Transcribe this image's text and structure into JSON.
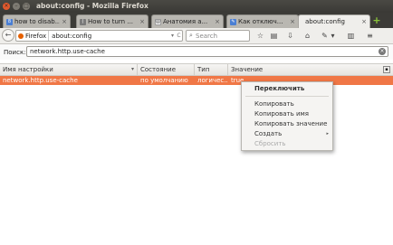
{
  "window": {
    "title": "about:config - Mozilla Firefox",
    "close_glyph": "×",
    "minimize_glyph": "–",
    "maximize_glyph": "□"
  },
  "tabs": [
    {
      "label": "how to disab...",
      "icon": "google-icon",
      "icon_char": "8",
      "icon_color": "#4a7fd4",
      "close": "×"
    },
    {
      "label": "How to turn ...",
      "icon": "page-icon",
      "icon_char": "(",
      "icon_color": "#7a7a7a",
      "close": "×"
    },
    {
      "label": "Анатомия а...",
      "icon": "wiki-icon",
      "icon_char": "W",
      "icon_color": "#555555",
      "close": "×"
    },
    {
      "label": "Как отключ...",
      "icon": "page-icon",
      "icon_char": "✎",
      "icon_color": "#4a7fd4",
      "close": "×"
    },
    {
      "label": "about:config",
      "icon": "none",
      "icon_char": "",
      "icon_color": "#efeeeb",
      "close": "×"
    }
  ],
  "new_tab_label": "+",
  "navbar": {
    "back_glyph": "←",
    "identity_label": "Firefox",
    "url": "about:config",
    "dropdown_glyph": "▾",
    "reload_glyph": "C",
    "search_placeholder": "Search",
    "search_glyph": "⌕",
    "toolbar_icons": [
      {
        "name": "bookmark-star-icon",
        "glyph": "☆"
      },
      {
        "name": "clipboard-icon",
        "glyph": "▤"
      },
      {
        "name": "download-icon",
        "glyph": "⇩"
      },
      {
        "name": "home-icon",
        "glyph": "⌂"
      },
      {
        "name": "tools-icon",
        "glyph": "✎"
      },
      {
        "name": "tools-dropdown-icon",
        "glyph": "▾"
      },
      {
        "name": "sidebar-icon",
        "glyph": "▥"
      },
      {
        "name": "menu-icon",
        "glyph": "≡"
      }
    ]
  },
  "filter": {
    "label": "Поиск:",
    "value": "network.http.use-cache",
    "clear_glyph": "×"
  },
  "table": {
    "columns": [
      "Имя настройки",
      "Состояние",
      "Тип",
      "Значение"
    ],
    "sort_glyph": "▾",
    "column_picker_glyph": "▪",
    "rows": [
      {
        "name": "network.http.use-cache",
        "state": "по умолчанию",
        "type": "логичес...",
        "value": "true"
      }
    ]
  },
  "context_menu": {
    "items": [
      {
        "label": "Переключить",
        "bold": true
      },
      {
        "label": "Копировать"
      },
      {
        "label": "Копировать имя"
      },
      {
        "label": "Копировать значение"
      },
      {
        "label": "Создать",
        "submenu_glyph": "▸"
      },
      {
        "label": "Сбросить",
        "disabled": true
      }
    ]
  }
}
